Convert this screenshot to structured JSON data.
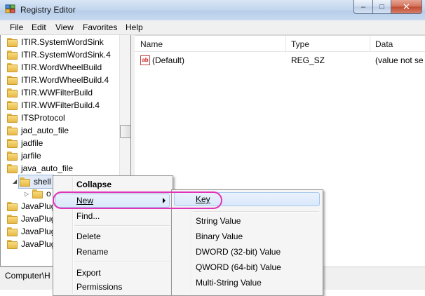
{
  "window": {
    "title": "Registry Editor"
  },
  "menubar": [
    "File",
    "Edit",
    "View",
    "Favorites",
    "Help"
  ],
  "tree": {
    "items": [
      "ITIR.SystemWordSink",
      "ITIR.SystemWordSink.4",
      "ITIR.WordWheelBuild",
      "ITIR.WordWheelBuild.4",
      "ITIR.WWFilterBuild",
      "ITIR.WWFilterBuild.4",
      "ITSProtocol",
      "jad_auto_file",
      "jadfile",
      "jarfile",
      "java_auto_file"
    ],
    "selected": "shell",
    "child_partial": "o",
    "after": [
      "JavaPlug",
      "JavaPlug",
      "JavaPlug",
      "JavaPlug"
    ]
  },
  "list": {
    "columns": [
      "Name",
      "Type",
      "Data"
    ],
    "rows": [
      {
        "name": "(Default)",
        "type": "REG_SZ",
        "data": "(value not se"
      }
    ]
  },
  "statusbar": {
    "path": "Computer\\H"
  },
  "context_menu": {
    "items": [
      "Collapse",
      "New",
      "Find...",
      "Delete",
      "Rename",
      "Export",
      "Permissions"
    ]
  },
  "submenu": {
    "items": [
      "Key",
      "String Value",
      "Binary Value",
      "DWORD (32-bit) Value",
      "QWORD (64-bit) Value",
      "Multi-String Value"
    ]
  },
  "colors": {
    "highlight_circle": "#e233b8",
    "menu_highlight": "#d9e8fb"
  }
}
